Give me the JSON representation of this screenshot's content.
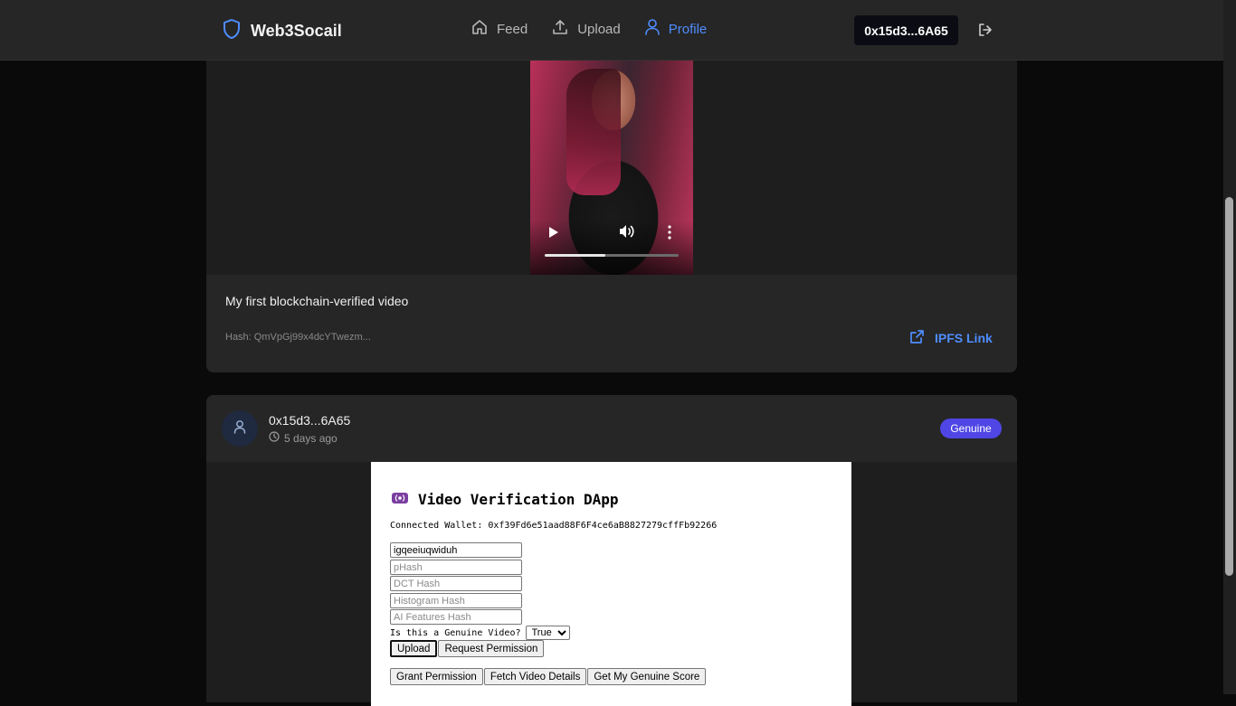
{
  "header": {
    "brand": "Web3Socail",
    "nav": [
      {
        "label": "Feed",
        "icon": "home-icon",
        "active": false
      },
      {
        "label": "Upload",
        "icon": "upload-icon",
        "active": false
      },
      {
        "label": "Profile",
        "icon": "user-icon",
        "active": true
      }
    ],
    "wallet_button": "0x15d3...6A65",
    "logout_icon": "logout-icon"
  },
  "colors": {
    "accent": "#4f8dff",
    "badge": "#4f46e5",
    "card": "#262626",
    "background": "#0a0a0a"
  },
  "post1": {
    "video": {
      "progress": 0.45
    },
    "caption": "My first blockchain-verified video",
    "hash": "Hash: QmVpGj99x4dcYTwezm...",
    "ipfs_link": "IPFS Link"
  },
  "post2": {
    "author": "0x15d3...6A65",
    "time": "5 days ago",
    "badge": "Genuine",
    "dapp": {
      "title": "Video Verification DApp",
      "wallet": "Connected Wallet: 0xf39Fd6e51aad88F6F4ce6aB8827279cffFb92266",
      "fields": [
        {
          "value": "igqeeiuqwiduh",
          "placeholder": ""
        },
        {
          "value": "",
          "placeholder": "pHash"
        },
        {
          "value": "",
          "placeholder": "DCT Hash"
        },
        {
          "value": "",
          "placeholder": "Histogram Hash"
        },
        {
          "value": "",
          "placeholder": "AI Features Hash"
        }
      ],
      "genuine_question": "Is this a Genuine Video?",
      "genuine_value": "True",
      "buttons_row1": [
        "Upload",
        "Request Permission"
      ],
      "buttons_row2": [
        "Grant Permission",
        "Fetch Video Details",
        "Get My Genuine Score"
      ]
    }
  }
}
